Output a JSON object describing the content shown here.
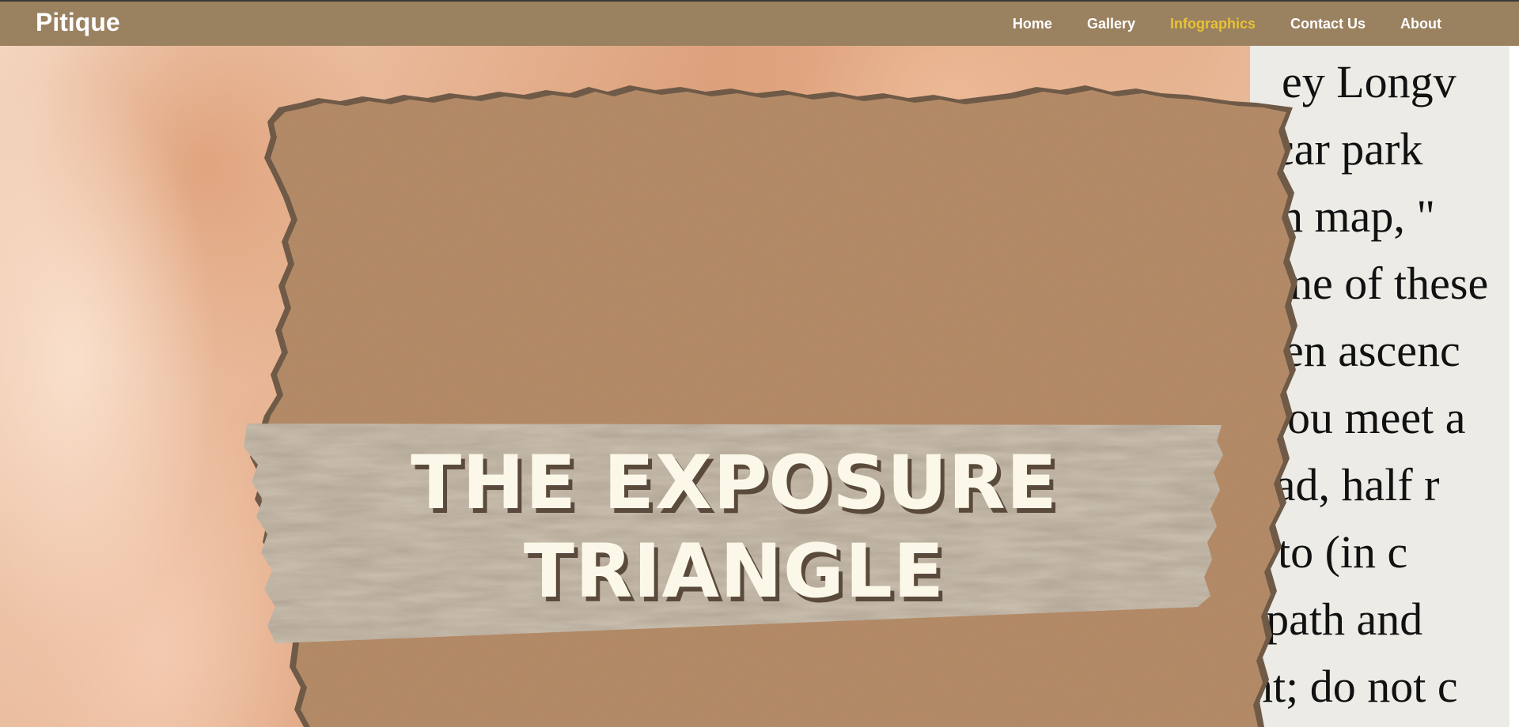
{
  "brand": "Pitique",
  "nav": {
    "items": [
      {
        "label": "Home",
        "active": false
      },
      {
        "label": "Gallery",
        "active": false
      },
      {
        "label": "Infographics",
        "active": true
      },
      {
        "label": "Contact Us",
        "active": false
      },
      {
        "label": "About",
        "active": false
      }
    ]
  },
  "hero": {
    "title_line1": "THE EXPOSURE",
    "title_line2": "TRIANGLE"
  },
  "newsprint": {
    "lines": [
      "ey Longv",
      "car park",
      "h  map, \"",
      "ne of these",
      "en ascenc",
      "you meet a",
      "ead, half r",
      ", to  (in  c",
      "tpath  and",
      "nt; do not c"
    ]
  },
  "colors": {
    "navbar": "#9a8160",
    "nav_active": "#e8c233",
    "nav_text": "#ffffff",
    "kraft": "#b78e6a",
    "title": "#fbf8ea",
    "title_shadow": "#5a4a3b"
  }
}
